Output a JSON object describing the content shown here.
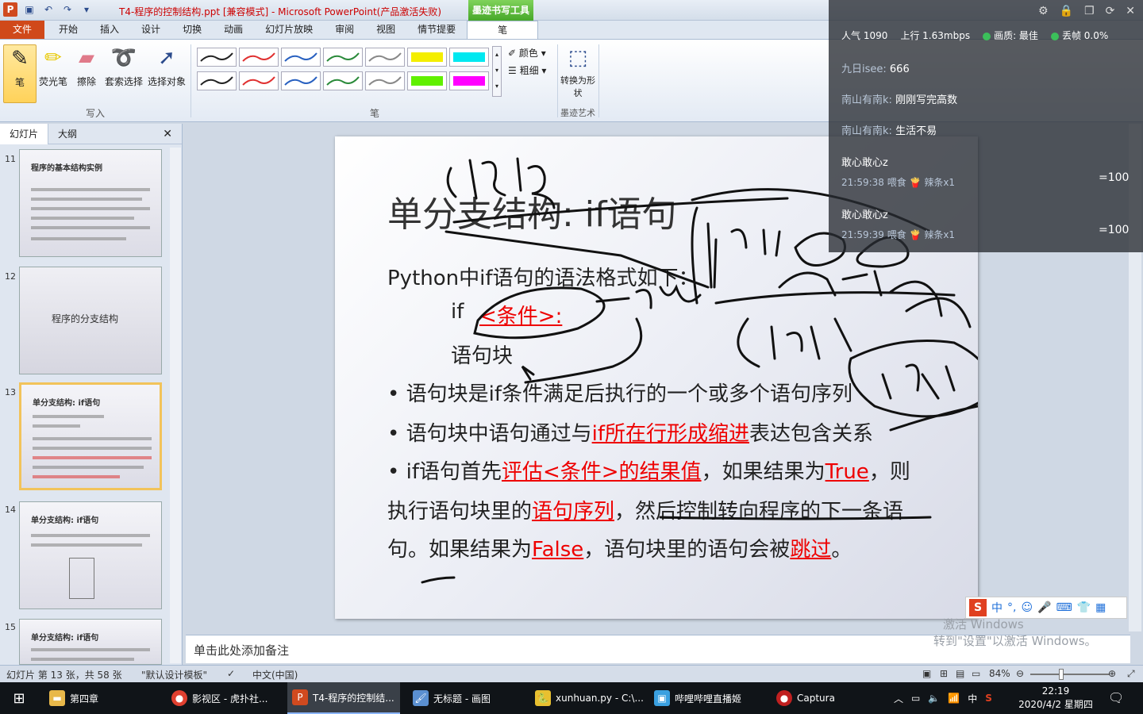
{
  "window": {
    "title": "T4-程序的控制结构.ppt [兼容模式] - Microsoft PowerPoint(产品激活失败)",
    "context_tab": "墨迹书写工具"
  },
  "tabs": [
    "文件",
    "开始",
    "插入",
    "设计",
    "切换",
    "动画",
    "幻灯片放映",
    "审阅",
    "视图",
    "情节提要",
    "笔"
  ],
  "ribbon": {
    "write_group": "写入",
    "pen_group": "笔",
    "ink_art_group": "墨迹艺术",
    "buttons": {
      "pen": "笔",
      "highlighter": "荧光笔",
      "eraser": "擦除",
      "lasso": "套索选择",
      "select": "选择对象",
      "color": "颜色",
      "weight": "粗细",
      "convert": "转换为形状"
    },
    "swatch_colors": [
      "#222222",
      "#e03030",
      "#2860c0",
      "#2a8a3a",
      "#888888",
      "#f4ee00",
      "#00e8f0",
      "#222222",
      "#e03030",
      "#2860c0",
      "#2a8a3a",
      "#888888",
      "#60f000",
      "#ff00ff"
    ]
  },
  "left_panel": {
    "tab_slides": "幻灯片",
    "tab_outline": "大纲",
    "slides": [
      {
        "num": "11",
        "title": "程序的基本结构实例"
      },
      {
        "num": "12",
        "title": "程序的分支结构"
      },
      {
        "num": "13",
        "title": "单分支结构: if语句"
      },
      {
        "num": "14",
        "title": "单分支结构: if语句"
      },
      {
        "num": "15",
        "title": "单分支结构: if语句"
      }
    ]
  },
  "slide": {
    "title": "单分支结构: if语句",
    "line1": "Python中if语句的语法格式如下：",
    "if_kw": "if",
    "cond": "<条件>:",
    "block": "语句块",
    "b1": "• 语句块是if条件满足后执行的一个或多个语句序列",
    "b2a": "• 语句块中语句通过与",
    "b2b": "if所在行形成缩进",
    "b2c": "表达包含关系",
    "b3a": "• if语句首先",
    "b3b": "评估<条件>的结果值",
    "b3c": "，如果结果为",
    "b3d": "True",
    "b3e": "，则",
    "b4a": "执行语句块里的",
    "b4b": "语句序列",
    "b4c": "，然后控制转向程序的下一条语",
    "b5a": "句。如果结果为",
    "b5b": "False",
    "b5c": "，语句块里的语句会被",
    "b5d": "跳过",
    "b5e": "。"
  },
  "notes_placeholder": "单击此处添加备注",
  "statusbar": {
    "slide_info": "幻灯片 第 13 张，共 58 张",
    "theme": "\"默认设计模板\"",
    "lang": "中文(中国)",
    "zoom": "84%"
  },
  "overlay": {
    "popularity": "人气 1090",
    "upload": "上行 1.63mbps",
    "quality": "画质: 最佳",
    "drop": "丢帧 0.0%",
    "chats": [
      {
        "user": "九日isee:",
        "text": "666"
      },
      {
        "user": "南山有南k:",
        "text": "刚刚写完高数"
      },
      {
        "user": "南山有南k:",
        "text": "生活不易"
      }
    ],
    "gifts": [
      {
        "user": "敢心敢心z",
        "time": "21:59:38 喂食",
        "item": "辣条x1",
        "amount": "=100"
      },
      {
        "user": "敢心敢心z",
        "time": "21:59:39 喂食",
        "item": "辣条x1",
        "amount": "=100"
      }
    ]
  },
  "activation": {
    "line1": "激活 Windows",
    "line2": "转到\"设置\"以激活 Windows。"
  },
  "ime": {
    "mode": "中"
  },
  "taskbar": {
    "items": [
      "第四章",
      "影视区 - 虎扑社...",
      "T4-程序的控制结...",
      "无标题 - 画图",
      "xunhuan.py - C:\\...",
      "哔哩哔哩直播姬",
      "Captura"
    ],
    "tray_ime": "中",
    "time": "22:19",
    "date": "2020/4/2 星期四"
  },
  "ink_colors": {
    "dark": "#111111"
  }
}
